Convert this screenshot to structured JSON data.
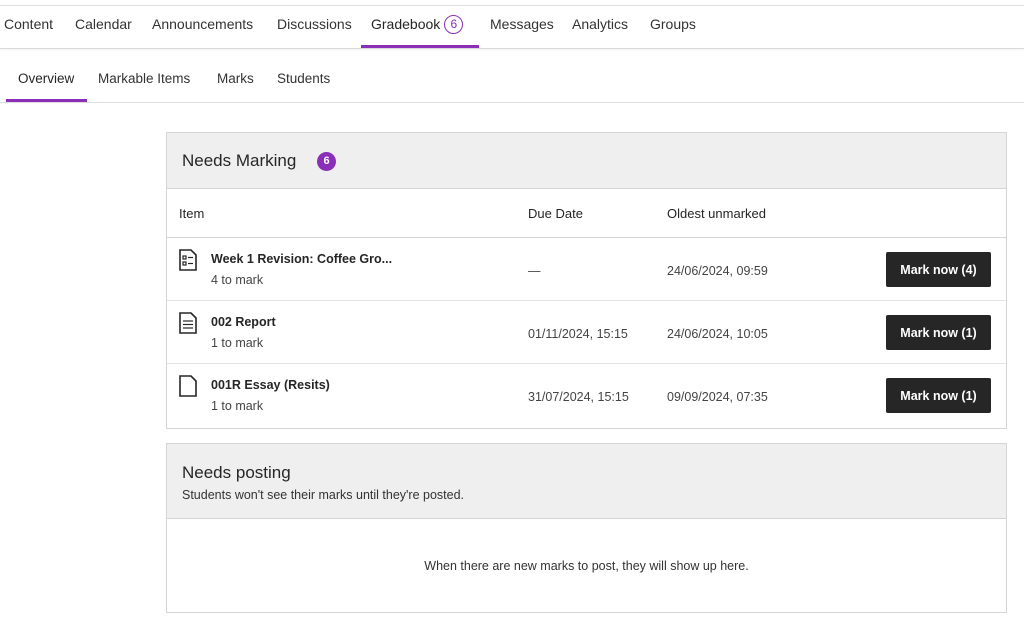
{
  "top_nav": {
    "items": [
      {
        "label": "Content"
      },
      {
        "label": "Calendar"
      },
      {
        "label": "Announcements"
      },
      {
        "label": "Discussions"
      },
      {
        "label": "Gradebook",
        "badge": "6"
      },
      {
        "label": "Messages"
      },
      {
        "label": "Analytics"
      },
      {
        "label": "Groups"
      }
    ],
    "active": "Gradebook"
  },
  "sub_nav": {
    "items": [
      {
        "label": "Overview"
      },
      {
        "label": "Markable Items"
      },
      {
        "label": "Marks"
      },
      {
        "label": "Students"
      }
    ],
    "active": "Overview"
  },
  "needs_marking": {
    "title": "Needs Marking",
    "count": "6",
    "columns": {
      "item": "Item",
      "due_date": "Due Date",
      "oldest": "Oldest unmarked"
    },
    "rows": [
      {
        "icon": "form-document-icon",
        "name": "Week 1 Revision: Coffee Gro...",
        "to_mark": "4 to mark",
        "due": "—",
        "oldest": "24/06/2024, 09:59",
        "button": "Mark now (4)"
      },
      {
        "icon": "text-document-icon",
        "name": "002 Report",
        "to_mark": "1 to mark",
        "due": "01/11/2024, 15:15",
        "oldest": "24/06/2024, 10:05",
        "button": "Mark now (1)"
      },
      {
        "icon": "blank-document-icon",
        "name": "001R Essay (Resits)",
        "to_mark": "1 to mark",
        "due": "31/07/2024, 15:15",
        "oldest": "09/09/2024, 07:35",
        "button": "Mark now (1)"
      }
    ]
  },
  "needs_posting": {
    "title": "Needs posting",
    "subtitle": "Students won't see their marks until they're posted.",
    "empty_message": "When there are new marks to post, they will show up here."
  },
  "colors": {
    "accent": "#8b2fb8",
    "button_bg": "#262626"
  }
}
